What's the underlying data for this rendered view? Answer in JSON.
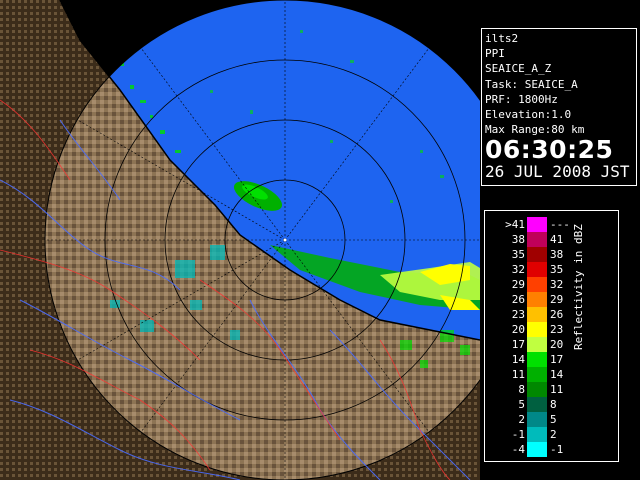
{
  "info": {
    "radar_name": "ilts2",
    "scan_mode": "PPI",
    "product": "SEAICE_A_Z",
    "task": "Task: SEAICE_A",
    "prf": "PRF: 1800Hz",
    "elevation": "Elevation:1.0",
    "max_range": "Max Range:80 km",
    "time": "06:30:25",
    "date": "26 JUL 2008 JST"
  },
  "legend": {
    "unit_label": "Reflectivity in dBZ",
    "rows": [
      {
        "low": ">41",
        "high": "---",
        "color": "#ff00ff"
      },
      {
        "low": "38",
        "high": "41",
        "color": "#c0005a"
      },
      {
        "low": "35",
        "high": "38",
        "color": "#a00000"
      },
      {
        "low": "32",
        "high": "35",
        "color": "#e00000"
      },
      {
        "low": "29",
        "high": "32",
        "color": "#ff4000"
      },
      {
        "low": "26",
        "high": "29",
        "color": "#ff8000"
      },
      {
        "low": "23",
        "high": "26",
        "color": "#ffc000"
      },
      {
        "low": "20",
        "high": "23",
        "color": "#ffff00"
      },
      {
        "low": "17",
        "high": "20",
        "color": "#c0ff40"
      },
      {
        "low": "14",
        "high": "17",
        "color": "#00e000"
      },
      {
        "low": "11",
        "high": "14",
        "color": "#00b000"
      },
      {
        "low": "8",
        "high": "11",
        "color": "#008800"
      },
      {
        "low": "5",
        "high": "8",
        "color": "#006040"
      },
      {
        "low": "2",
        "high": "5",
        "color": "#008888"
      },
      {
        "low": "-1",
        "high": "2",
        "color": "#00bbbb"
      },
      {
        "low": "-4",
        "high": "-1",
        "color": "#00ffff"
      }
    ]
  },
  "colors": {
    "sea": "#1e64f0",
    "land": "#6b5030",
    "rings": "#000000",
    "coast": "#000000"
  }
}
